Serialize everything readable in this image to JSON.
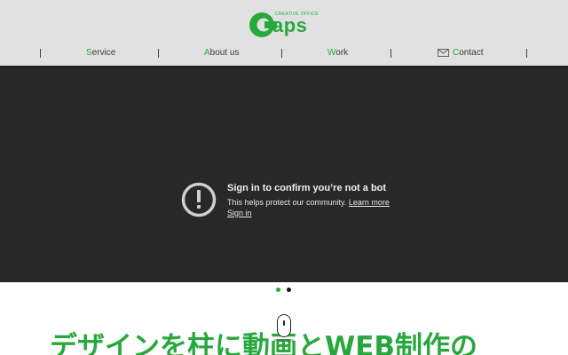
{
  "brand": {
    "logo_tagline": "CREATIVE OFFICE",
    "logo_word": "aps",
    "accent_color": "#27a83c"
  },
  "nav": {
    "items": [
      {
        "first": "S",
        "rest": "ervice"
      },
      {
        "first": "A",
        "rest": "bout us"
      },
      {
        "first": "W",
        "rest": "ork"
      },
      {
        "first": "C",
        "rest": "ontact",
        "icon": "mail-icon"
      }
    ]
  },
  "video_embed": {
    "icon": "exclamation-circle-icon",
    "title": "Sign in to confirm you’re not a bot",
    "body": "This helps protect our community.",
    "learn_more": "Learn more",
    "sign_in": "Sign in"
  },
  "slider": {
    "active_index": 0,
    "count": 2
  },
  "scroll_hint": {
    "label": "Scroll down",
    "icon": "mouse-icon"
  },
  "main": {
    "headline": "デザインを柱に動画とWEB制作の"
  }
}
